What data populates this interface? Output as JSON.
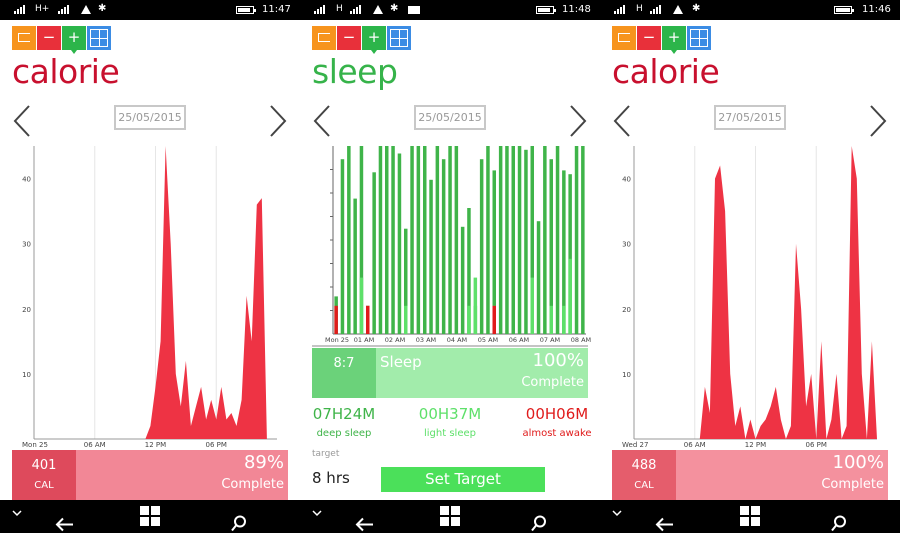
{
  "colors": {
    "calorie_red": "#c8102e",
    "area_red": "#ee3344",
    "sleep_green": "#36b34a",
    "deep_green": "#3fb449",
    "light_green": "#5ee06a",
    "awake_red": "#e01b1b"
  },
  "screens": [
    {
      "status": {
        "net": "H+",
        "time": "11:47"
      },
      "title": "calorie",
      "date": "25/05/2015",
      "summary": {
        "value": "401",
        "unit": "CAL",
        "percent": "89%",
        "label": "Complete"
      }
    },
    {
      "status": {
        "net": "H",
        "time": "11:48"
      },
      "title": "sleep",
      "date": "25/05/2015",
      "summary": {
        "value": "8:7",
        "label_left": "Sleep",
        "percent": "100%",
        "label": "Complete"
      },
      "stats": [
        {
          "value": "07H24M",
          "caption": "deep sleep"
        },
        {
          "value": "00H37M",
          "caption": "light sleep"
        },
        {
          "value": "00H06M",
          "caption": "almost awake"
        }
      ],
      "target": {
        "label": "target",
        "hours": "8 hrs",
        "button": "Set Target"
      }
    },
    {
      "status": {
        "net": "H",
        "time": "11:46"
      },
      "title": "calorie",
      "date": "27/05/2015",
      "summary": {
        "value": "488",
        "unit": "CAL",
        "percent": "100%",
        "label": "Complete"
      }
    }
  ],
  "tile_icons": [
    "calendar-icon",
    "minus-icon",
    "plus-icon",
    "grid-icon"
  ],
  "tile_glyphs": {
    "minus": "−",
    "plus": "+"
  },
  "chart_data": [
    {
      "type": "area",
      "x_ticks": [
        "Mon 25",
        "06 AM",
        "12 PM",
        "06 PM"
      ],
      "ylim": [
        0,
        45
      ],
      "y_ticks": [
        "10",
        "20",
        "30",
        "40"
      ],
      "x": [
        0,
        10,
        11,
        11.5,
        12,
        12.5,
        13,
        13.5,
        14,
        14.5,
        15,
        15.5,
        16,
        16.5,
        17,
        17.5,
        18,
        18.5,
        19,
        19.5,
        20,
        20.5,
        21,
        21.5,
        22,
        22.5,
        23,
        23.5,
        24
      ],
      "values": [
        0,
        0,
        0,
        2,
        8,
        15,
        45,
        30,
        10,
        5,
        12,
        2,
        5,
        8,
        3,
        6,
        3,
        8,
        3,
        4,
        2,
        6,
        22,
        15,
        36,
        37,
        0,
        0,
        0
      ]
    },
    {
      "type": "bar",
      "x_ticks": [
        "Mon 25",
        "01 AM",
        "02 AM",
        "03 AM",
        "04 AM",
        "05 AM",
        "06 AM",
        "07 AM",
        "08 AM"
      ],
      "ylim": [
        0,
        1
      ],
      "series": [
        {
          "name": "deep sleep",
          "values": [
            0.2,
            0.93,
            1,
            0.72,
            1,
            0.15,
            0.86,
            1,
            1,
            1,
            0.96,
            0.56,
            1,
            1,
            1,
            0.82,
            1,
            0.93,
            1,
            1,
            0.57,
            0.67,
            0.15,
            0.93,
            1,
            0.87,
            1,
            1,
            1,
            1,
            0.98,
            1,
            0.6,
            1,
            0.93,
            1,
            0.87,
            0.85,
            1,
            1
          ]
        },
        {
          "name": "light sleep",
          "values": [
            0,
            0,
            0,
            0,
            0.3,
            0,
            0,
            0,
            0,
            0,
            0,
            0.15,
            0,
            0,
            0,
            0,
            0,
            0,
            0,
            0,
            0,
            0.15,
            0.3,
            0,
            0,
            0.15,
            0,
            0,
            0,
            0,
            0,
            0.3,
            0,
            0,
            0.15,
            0,
            0.15,
            0.4,
            0,
            0
          ]
        },
        {
          "name": "almost awake",
          "values": [
            0.15,
            0,
            0,
            0,
            0,
            0.15,
            0,
            0,
            0,
            0,
            0,
            0,
            0,
            0,
            0,
            0,
            0,
            0,
            0,
            0,
            0,
            0,
            0,
            0,
            0,
            0.15,
            0,
            0,
            0,
            0,
            0,
            0,
            0,
            0,
            0,
            0,
            0,
            0,
            0,
            0
          ]
        }
      ]
    },
    {
      "type": "area",
      "x_ticks": [
        "Wed 27",
        "06 AM",
        "12 PM",
        "06 PM"
      ],
      "ylim": [
        0,
        45
      ],
      "y_ticks": [
        "10",
        "20",
        "30",
        "40"
      ],
      "x": [
        0,
        6,
        6.5,
        7,
        7.5,
        8,
        8.5,
        9,
        9.5,
        10,
        10.5,
        11,
        11.5,
        12,
        12.5,
        13,
        13.5,
        14,
        14.5,
        15,
        15.5,
        16,
        16.5,
        17,
        17.5,
        18,
        18.5,
        19,
        19.5,
        20,
        20.5,
        21,
        21.5,
        22,
        22.5,
        23,
        23.5,
        24
      ],
      "values": [
        0,
        0,
        0,
        8,
        4,
        40,
        42,
        35,
        10,
        2,
        5,
        0,
        3,
        0,
        2,
        3,
        5,
        8,
        3,
        0,
        2,
        30,
        20,
        5,
        10,
        0,
        15,
        0,
        3,
        10,
        0,
        2,
        45,
        40,
        10,
        0,
        15,
        0
      ]
    }
  ]
}
